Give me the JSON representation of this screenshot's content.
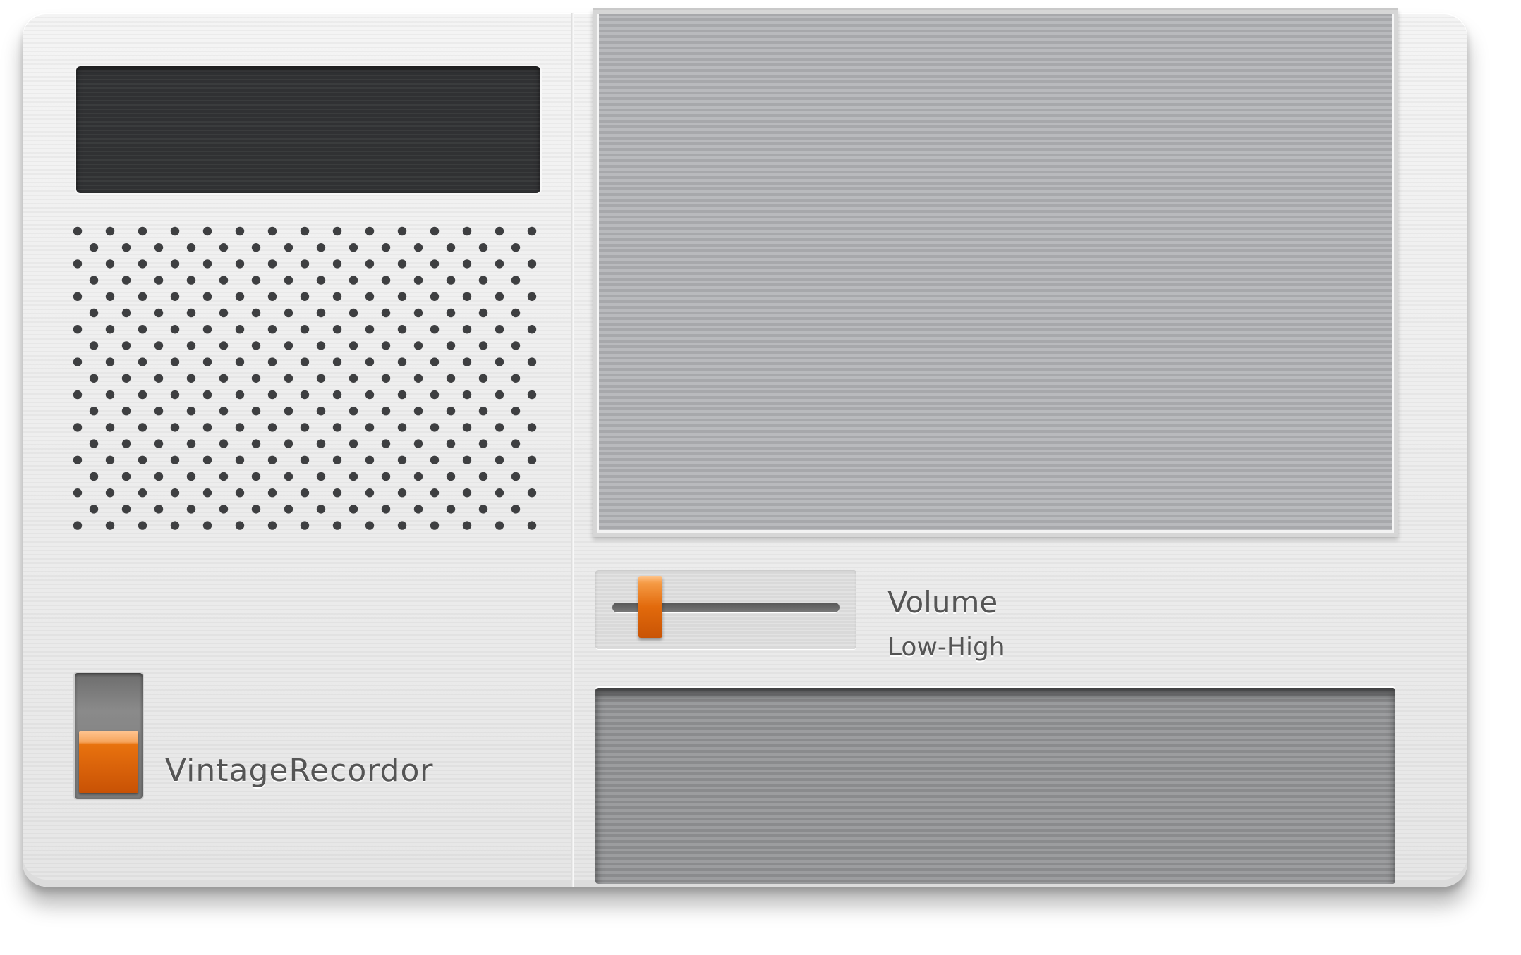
{
  "app": {
    "brand_label": "VintageRecordor",
    "display_text": ""
  },
  "volume": {
    "title": "Volume",
    "range_label": "Low-High",
    "level": 0.13
  },
  "power_switch": {
    "state": "on"
  },
  "colors": {
    "accent": "#e8720e",
    "body": "#eeeeee",
    "display": "#303133",
    "cassette_window": "#b1b2b5",
    "tape_well": "#929395"
  }
}
